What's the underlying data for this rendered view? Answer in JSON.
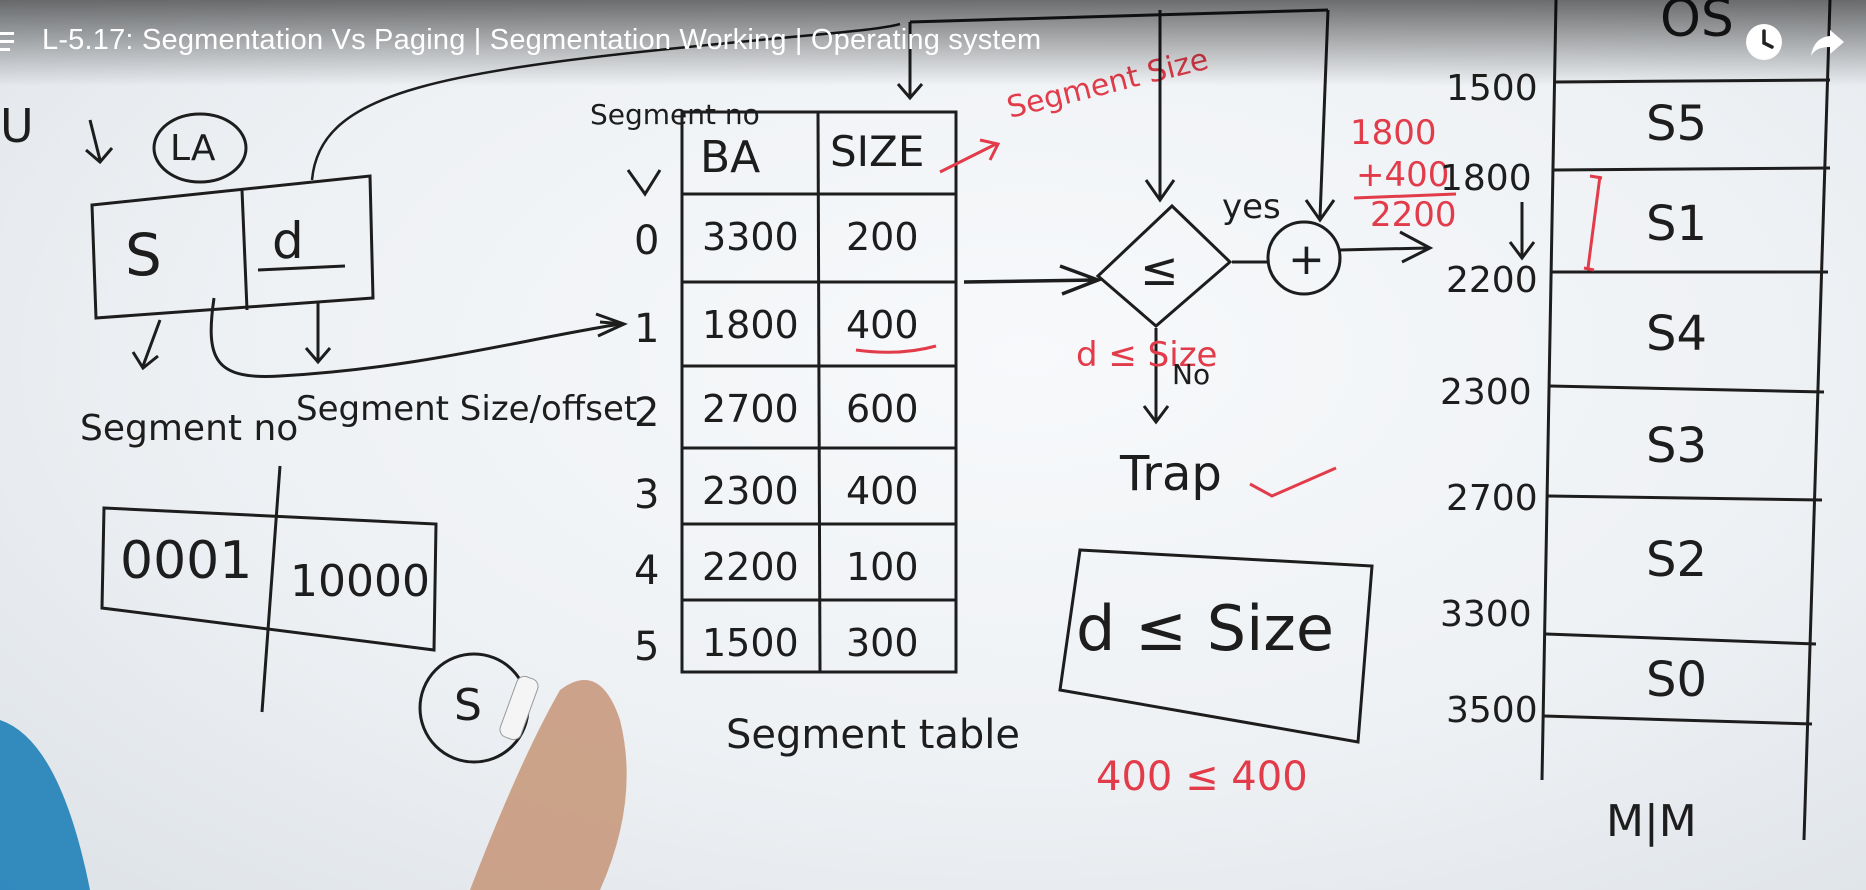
{
  "player": {
    "title": "L-5.17: Segmentation Vs Paging | Segmentation Working | Operating system",
    "icons": {
      "menu": "playlist-icon",
      "watch_later": "clock-icon",
      "share": "share-arrow-icon"
    }
  },
  "board": {
    "top_left": {
      "cpu": "U",
      "logical_address": "LA",
      "s": "S",
      "d": "d"
    },
    "labels": {
      "segment_no": "Segment no",
      "segment_size": "Segment Size/offset"
    },
    "address_bits": {
      "segment": "0001",
      "offset": "10000"
    },
    "segment_table": {
      "header_row_label": "Segment no",
      "columns": [
        "BA",
        "SIZE"
      ],
      "rows": [
        {
          "seg": "0",
          "ba": "3300",
          "size": "200"
        },
        {
          "seg": "1",
          "ba": "1800",
          "size": "400"
        },
        {
          "seg": "2",
          "ba": "2700",
          "size": "600"
        },
        {
          "seg": "3",
          "ba": "2300",
          "size": "400"
        },
        {
          "seg": "4",
          "ba": "2200",
          "size": "100"
        },
        {
          "seg": "5",
          "ba": "1500",
          "size": "300"
        }
      ],
      "caption": "Segment table",
      "size_note": "Segment Size"
    },
    "comparator": {
      "symbol": "≤",
      "yes": "yes",
      "no": "No",
      "condition": "d ≤ Size",
      "trap": "Trap",
      "plus": "+",
      "sum_lines": [
        "1800",
        "+400",
        "2200"
      ]
    },
    "condition_box": {
      "text": "d ≤ Size",
      "example": "400 ≤ 400"
    },
    "memory": {
      "title": "OS",
      "addresses": [
        "1500",
        "1800",
        "2200",
        "2300",
        "2700",
        "3300",
        "3500"
      ],
      "segments": [
        "S5",
        "S1",
        "S4",
        "S3",
        "S2",
        "S0"
      ],
      "caption": "M|M"
    },
    "circle_note": "S"
  },
  "colors": {
    "ink": "#1d1d1d",
    "red_marker": "#e23b4a",
    "board": "#f4f6f8"
  }
}
